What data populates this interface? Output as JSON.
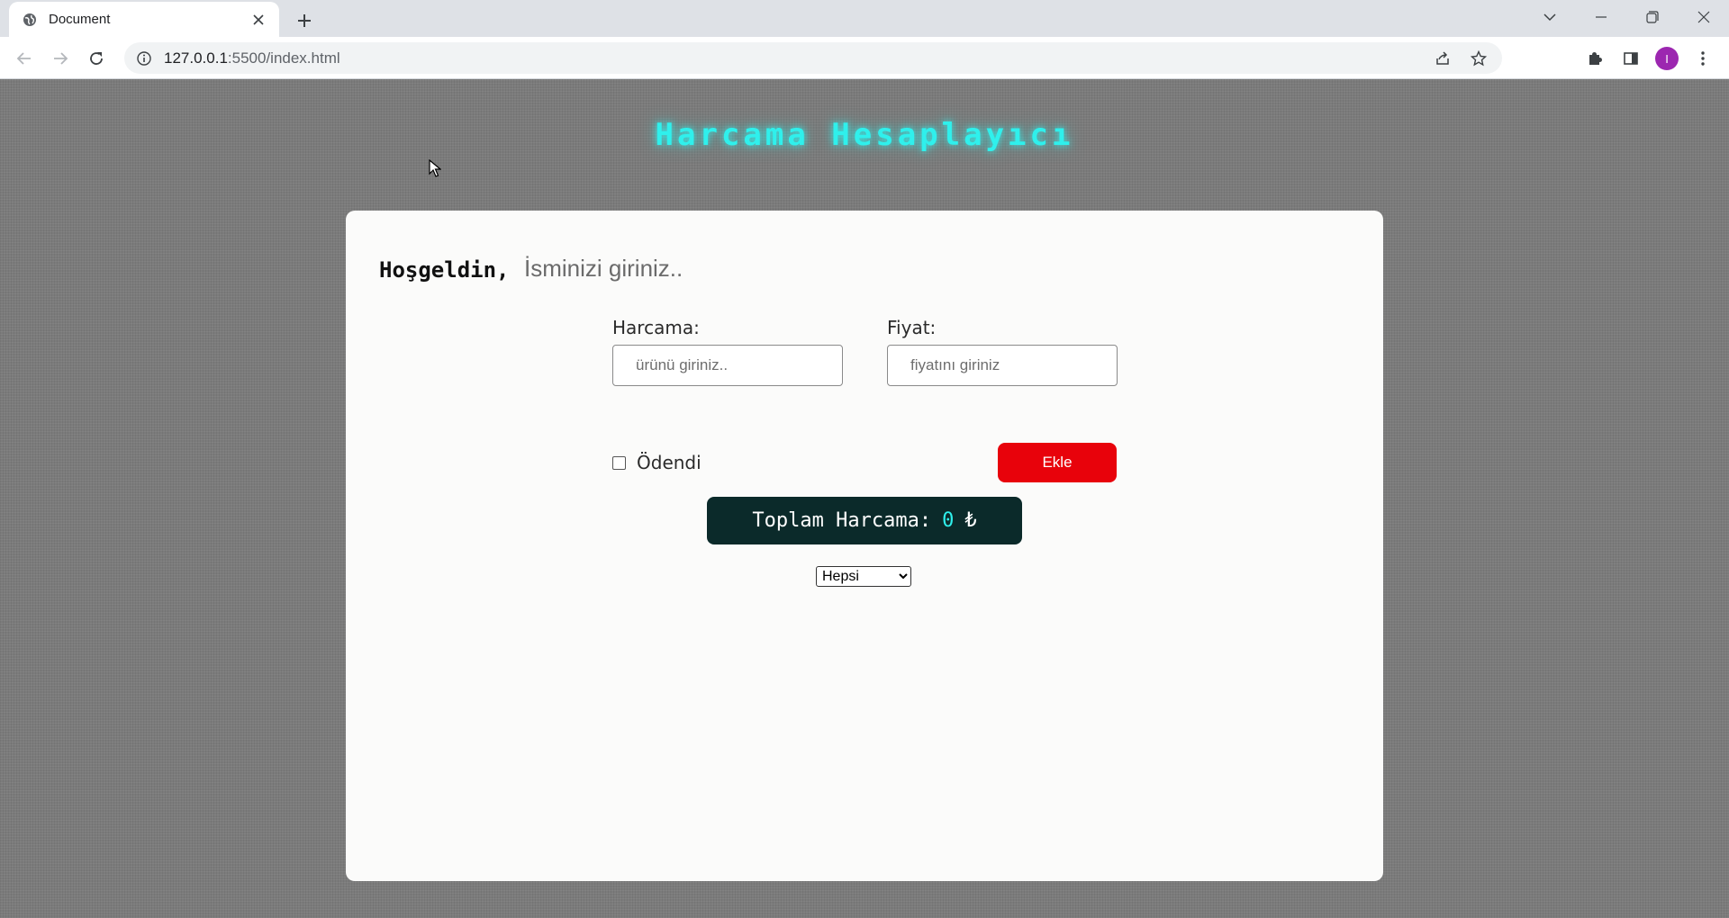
{
  "browser": {
    "tab": {
      "title": "Document"
    },
    "url": {
      "host": "127.0.0.1",
      "rest": ":5500/index.html"
    },
    "icons": {
      "favicon": "globe-icon",
      "tab_close": "close-icon",
      "new_tab": "plus-icon",
      "tab_search": "chevron-down-icon",
      "minimize": "minimize-icon",
      "restore": "restore-icon",
      "close_window": "close-icon",
      "back": "back-arrow-icon",
      "forward": "forward-arrow-icon",
      "reload": "reload-icon",
      "site_info": "info-icon",
      "share": "share-icon",
      "bookmark": "star-icon",
      "extensions": "puzzle-icon",
      "side_panel": "side-panel-icon",
      "menu": "kebab-menu-icon"
    },
    "profile": {
      "initial": "I",
      "color": "#9c27b0"
    }
  },
  "page": {
    "title": "Harcama Hesaplayıcı",
    "welcome": "Hoşgeldin,",
    "name_placeholder": "İsminizi giriniz..",
    "expense": {
      "label": "Harcama:",
      "placeholder": "ürünü giriniz.."
    },
    "price": {
      "label": "Fiyat:",
      "placeholder": "fiyatını giriniz"
    },
    "paid": {
      "label": "Ödendi",
      "checked": false
    },
    "add_button": "Ekle",
    "total": {
      "label": "Toplam Harcama:",
      "amount": "0",
      "currency": "₺"
    },
    "filter": {
      "selected": "Hepsi"
    },
    "colors": {
      "accent": "#2ff0ec",
      "add_button": "#e8020b",
      "total_bg": "#0b2a2a",
      "card_bg": "#fbfbfa",
      "page_bg": "#7b7b7b"
    }
  }
}
